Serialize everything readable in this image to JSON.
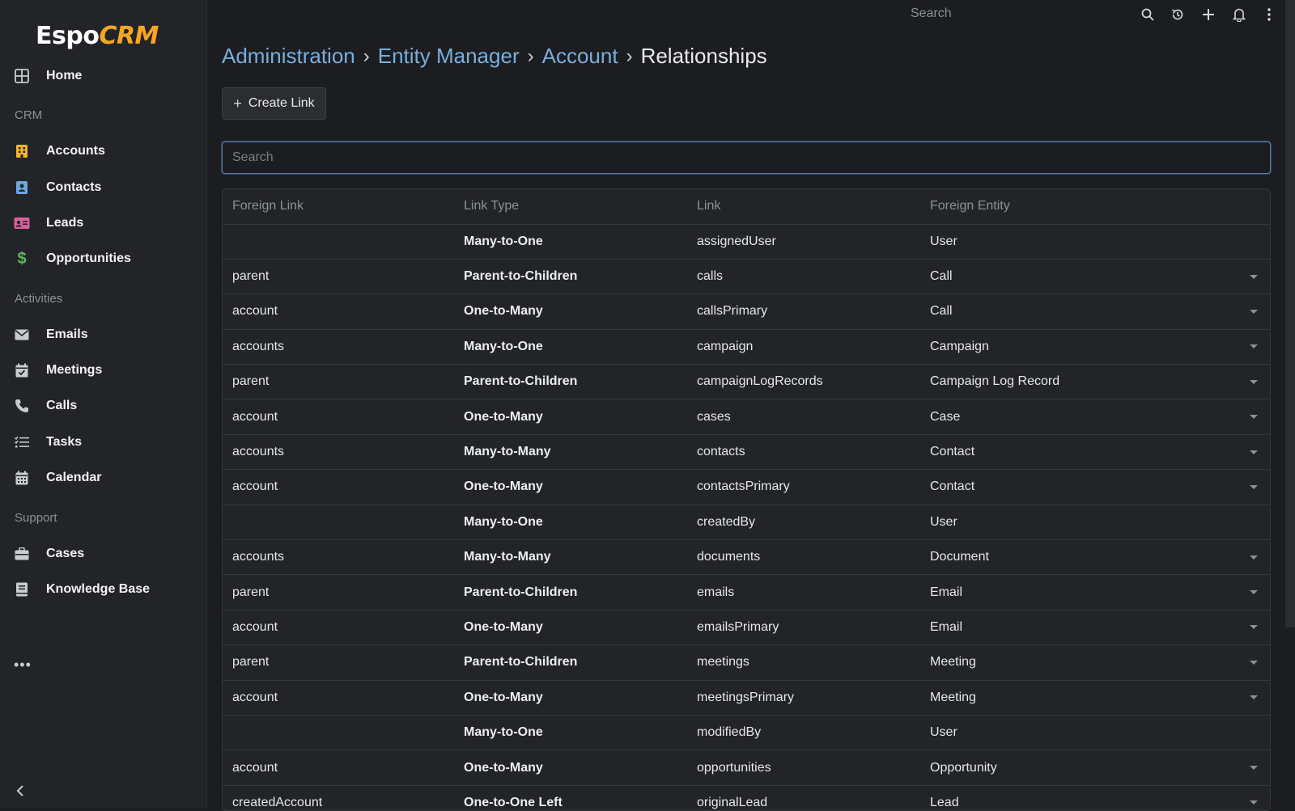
{
  "brand": {
    "part1": "Espo",
    "part2": "CRM"
  },
  "sidebar": {
    "home": "Home",
    "groups": {
      "crm": "CRM",
      "activities": "Activities",
      "support": "Support"
    },
    "crm_items": [
      "Accounts",
      "Contacts",
      "Leads",
      "Opportunities"
    ],
    "activity_items": [
      "Emails",
      "Meetings",
      "Calls",
      "Tasks",
      "Calendar"
    ],
    "support_items": [
      "Cases",
      "Knowledge Base"
    ],
    "more": "•••"
  },
  "topbar": {
    "search_placeholder": "Search"
  },
  "breadcrumb": {
    "items": [
      "Administration",
      "Entity Manager",
      "Account"
    ],
    "current": "Relationships",
    "separator": "›"
  },
  "toolbar": {
    "create_link_label": "Create Link",
    "plus": "+"
  },
  "filter": {
    "placeholder": "Search"
  },
  "table": {
    "headers": [
      "Foreign Link",
      "Link Type",
      "Link",
      "Foreign Entity"
    ],
    "rows": [
      {
        "foreign_link": "",
        "link_type": "Many-to-One",
        "link": "assignedUser",
        "foreign_entity": "User",
        "has_menu": false
      },
      {
        "foreign_link": "parent",
        "link_type": "Parent-to-Children",
        "link": "calls",
        "foreign_entity": "Call",
        "has_menu": true
      },
      {
        "foreign_link": "account",
        "link_type": "One-to-Many",
        "link": "callsPrimary",
        "foreign_entity": "Call",
        "has_menu": true
      },
      {
        "foreign_link": "accounts",
        "link_type": "Many-to-One",
        "link": "campaign",
        "foreign_entity": "Campaign",
        "has_menu": true
      },
      {
        "foreign_link": "parent",
        "link_type": "Parent-to-Children",
        "link": "campaignLogRecords",
        "foreign_entity": "Campaign Log Record",
        "has_menu": true
      },
      {
        "foreign_link": "account",
        "link_type": "One-to-Many",
        "link": "cases",
        "foreign_entity": "Case",
        "has_menu": true
      },
      {
        "foreign_link": "accounts",
        "link_type": "Many-to-Many",
        "link": "contacts",
        "foreign_entity": "Contact",
        "has_menu": true
      },
      {
        "foreign_link": "account",
        "link_type": "One-to-Many",
        "link": "contactsPrimary",
        "foreign_entity": "Contact",
        "has_menu": true
      },
      {
        "foreign_link": "",
        "link_type": "Many-to-One",
        "link": "createdBy",
        "foreign_entity": "User",
        "has_menu": false
      },
      {
        "foreign_link": "accounts",
        "link_type": "Many-to-Many",
        "link": "documents",
        "foreign_entity": "Document",
        "has_menu": true
      },
      {
        "foreign_link": "parent",
        "link_type": "Parent-to-Children",
        "link": "emails",
        "foreign_entity": "Email",
        "has_menu": true
      },
      {
        "foreign_link": "account",
        "link_type": "One-to-Many",
        "link": "emailsPrimary",
        "foreign_entity": "Email",
        "has_menu": true
      },
      {
        "foreign_link": "parent",
        "link_type": "Parent-to-Children",
        "link": "meetings",
        "foreign_entity": "Meeting",
        "has_menu": true
      },
      {
        "foreign_link": "account",
        "link_type": "One-to-Many",
        "link": "meetingsPrimary",
        "foreign_entity": "Meeting",
        "has_menu": true
      },
      {
        "foreign_link": "",
        "link_type": "Many-to-One",
        "link": "modifiedBy",
        "foreign_entity": "User",
        "has_menu": false
      },
      {
        "foreign_link": "account",
        "link_type": "One-to-Many",
        "link": "opportunities",
        "foreign_entity": "Opportunity",
        "has_menu": true
      },
      {
        "foreign_link": "createdAccount",
        "link_type": "One-to-One Left",
        "link": "originalLead",
        "foreign_entity": "Lead",
        "has_menu": true
      }
    ]
  },
  "colors": {
    "accent_link": "#7aaedc",
    "brand_orange": "#f5a623",
    "background": "#1c1d20",
    "sidebar": "#232428"
  }
}
